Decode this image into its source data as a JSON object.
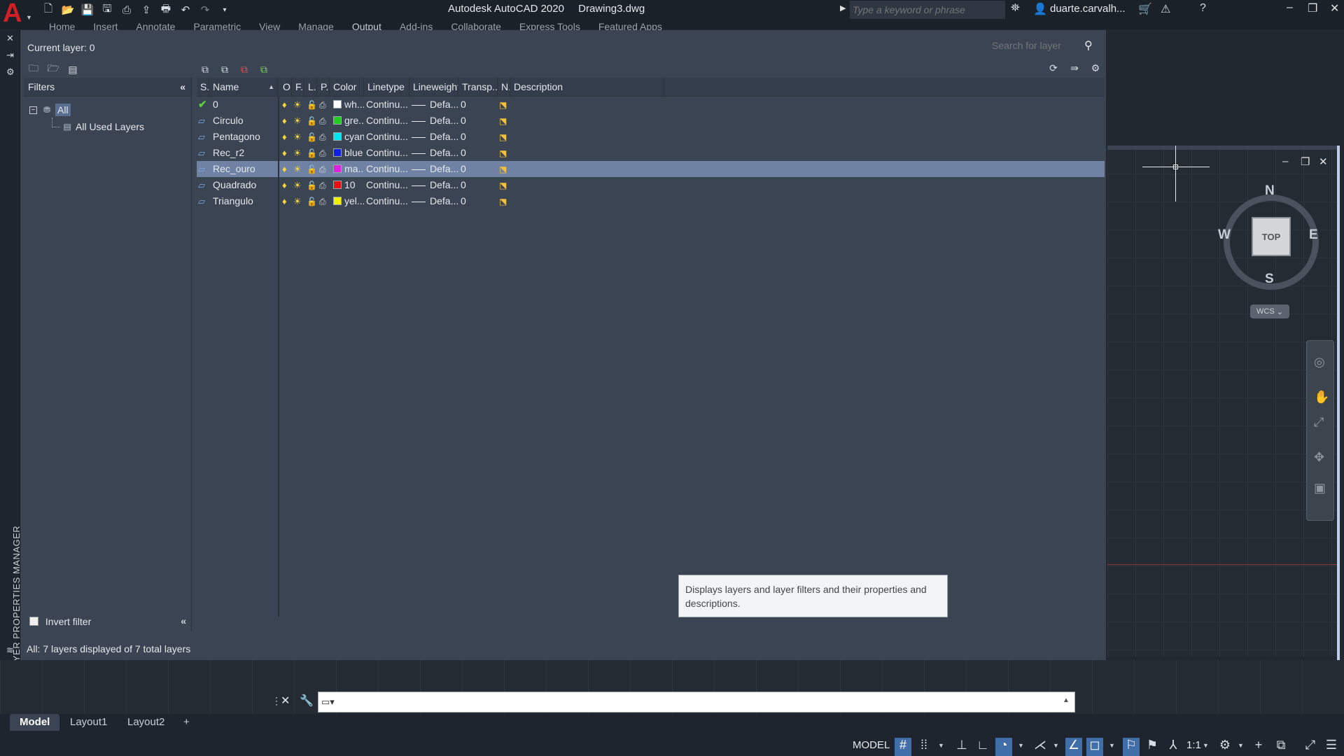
{
  "titlebar": {
    "app_letter": "A",
    "app_name": "Autodesk AutoCAD 2020",
    "document": "Drawing3.dwg",
    "search_placeholder": "Type a keyword or phrase",
    "user": "duarte.carvalh...",
    "ribbon_tabs": [
      "Home",
      "Insert",
      "Annotate",
      "Parametric",
      "View",
      "Manage",
      "Output",
      "Add-ins",
      "Collaborate",
      "Express Tools",
      "Featured Apps"
    ],
    "active_ribbon_tab": "Output"
  },
  "palette": {
    "vertical_title": "LAYER PROPERTIES MANAGER",
    "current_layer": "Current layer: 0",
    "search_placeholder": "Search for layer",
    "status": "All: 7 layers displayed of 7 total layers",
    "tooltip": "Displays layers and layer filters and their properties and descriptions."
  },
  "filters": {
    "header": "Filters",
    "tree_root": "All",
    "tree_child": "All Used Layers",
    "invert_filter": "Invert filter"
  },
  "columns": {
    "status": "S..",
    "name": "Name",
    "on": "O..",
    "freeze": "F...",
    "lock": "L...",
    "plot": "P..",
    "color": "Color",
    "linetype": "Linetype",
    "lineweight": "Lineweight",
    "transparency": "Transp...",
    "newvp": "N..",
    "description": "Description"
  },
  "layers": [
    {
      "name": "0",
      "current": true,
      "color_label": "wh...",
      "color_hex": "#ffffff",
      "linetype": "Continu...",
      "lineweight": "Defa...",
      "transparency": "0",
      "selected": false
    },
    {
      "name": "Circulo",
      "current": false,
      "color_label": "gre...",
      "color_hex": "#22cc22",
      "linetype": "Continu...",
      "lineweight": "Defa...",
      "transparency": "0",
      "selected": false
    },
    {
      "name": "Pentagono",
      "current": false,
      "color_label": "cyan",
      "color_hex": "#00e5f0",
      "linetype": "Continu...",
      "lineweight": "Defa...",
      "transparency": "0",
      "selected": false
    },
    {
      "name": "Rec_r2",
      "current": false,
      "color_label": "blue",
      "color_hex": "#1020e8",
      "linetype": "Continu...",
      "lineweight": "Defa...",
      "transparency": "0",
      "selected": false
    },
    {
      "name": "Rec_ouro",
      "current": false,
      "color_label": "ma...",
      "color_hex": "#e020e0",
      "linetype": "Continu...",
      "lineweight": "Defa...",
      "transparency": "0",
      "selected": true
    },
    {
      "name": "Quadrado",
      "current": false,
      "color_label": "10",
      "color_hex": "#e81010",
      "linetype": "Continu...",
      "lineweight": "Defa...",
      "transparency": "0",
      "selected": false
    },
    {
      "name": "Triangulo",
      "current": false,
      "color_label": "yel...",
      "color_hex": "#f0f000",
      "linetype": "Continu...",
      "lineweight": "Defa...",
      "transparency": "0",
      "selected": false
    }
  ],
  "viewcube": {
    "north": "N",
    "south": "S",
    "east": "E",
    "west": "W",
    "face": "TOP",
    "ucs": "WCS"
  },
  "layout_tabs": [
    "Model",
    "Layout1",
    "Layout2"
  ],
  "active_layout": "Model",
  "statusbar": {
    "model": "MODEL",
    "scale": "1:1"
  },
  "colors": {
    "accent": "#3f6ea8",
    "selection": "#6f82a3",
    "panel": "#3b4453",
    "logo_red": "#d01f25"
  }
}
